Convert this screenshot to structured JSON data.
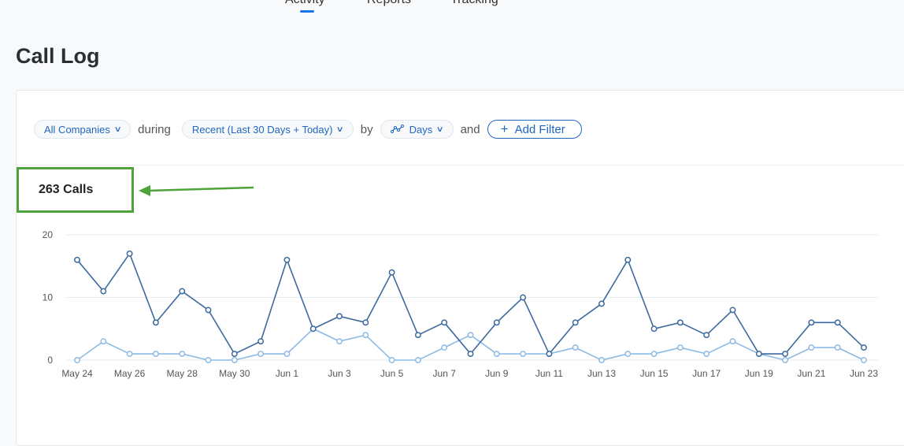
{
  "nav": {
    "tabs": [
      "Activity",
      "Reports",
      "Tracking"
    ],
    "active": "Activity"
  },
  "page": {
    "title": "Call Log"
  },
  "filters": {
    "company": "All Companies",
    "during": "during",
    "range": "Recent (Last 30 Days + Today)",
    "by": "by",
    "interval": "Days",
    "and": "and",
    "add_filter": "Add Filter"
  },
  "summary": {
    "total": "263 Calls"
  },
  "colors": {
    "series_dark": "#3d6a9e",
    "series_light": "#8cbbe6",
    "accent": "#1f66c1",
    "highlight": "#4ea33a"
  },
  "chart_data": {
    "type": "line",
    "x": [
      "May 24",
      "May 25",
      "May 26",
      "May 27",
      "May 28",
      "May 29",
      "May 30",
      "May 31",
      "Jun 1",
      "Jun 2",
      "Jun 3",
      "Jun 4",
      "Jun 5",
      "Jun 6",
      "Jun 7",
      "Jun 8",
      "Jun 9",
      "Jun 10",
      "Jun 11",
      "Jun 12",
      "Jun 13",
      "Jun 14",
      "Jun 15",
      "Jun 16",
      "Jun 17",
      "Jun 18",
      "Jun 19",
      "Jun 20",
      "Jun 21",
      "Jun 22",
      "Jun 23"
    ],
    "tick_labels": [
      "May 24",
      "May 26",
      "May 28",
      "May 30",
      "Jun 1",
      "Jun 3",
      "Jun 5",
      "Jun 7",
      "Jun 9",
      "Jun 11",
      "Jun 13",
      "Jun 15",
      "Jun 17",
      "Jun 19",
      "Jun 21",
      "Jun 23"
    ],
    "y_ticks": [
      "0",
      "10",
      "20"
    ],
    "ylim": [
      0,
      20
    ],
    "grid": true,
    "series": [
      {
        "name": "dark",
        "values": [
          16,
          11,
          17,
          6,
          11,
          8,
          1,
          3,
          16,
          5,
          7,
          6,
          14,
          4,
          6,
          1,
          6,
          10,
          1,
          6,
          9,
          16,
          5,
          6,
          4,
          8,
          1,
          1,
          6,
          6,
          2
        ]
      },
      {
        "name": "light",
        "values": [
          0,
          3,
          1,
          1,
          1,
          0,
          0,
          1,
          1,
          5,
          3,
          4,
          0,
          0,
          2,
          4,
          1,
          1,
          1,
          2,
          0,
          1,
          1,
          2,
          1,
          3,
          1,
          0,
          2,
          2,
          0
        ]
      }
    ]
  }
}
